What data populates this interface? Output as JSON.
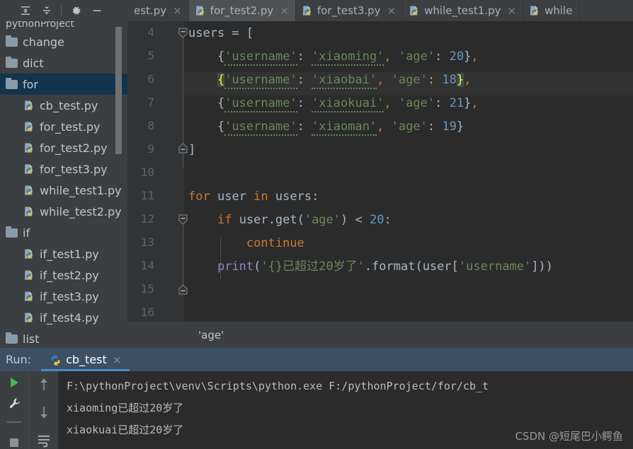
{
  "toolbar": {
    "expand_all": "expand-all",
    "collapse_all": "collapse-all",
    "settings": "settings",
    "minimize": "minimize"
  },
  "tabs": [
    {
      "label": "est.py",
      "active": false,
      "truncated": true
    },
    {
      "label": "for_test2.py",
      "active": true
    },
    {
      "label": "for_test3.py",
      "active": false
    },
    {
      "label": "while_test1.py",
      "active": false
    },
    {
      "label": "while",
      "active": false,
      "truncated": true
    }
  ],
  "close_glyph": "×",
  "sidebar": {
    "project_header": "pythonProject",
    "items": [
      {
        "label": "change",
        "type": "folder",
        "selected": false
      },
      {
        "label": "dict",
        "type": "folder",
        "selected": false
      },
      {
        "label": "for",
        "type": "folder",
        "selected": true
      },
      {
        "label": "cb_test.py",
        "type": "file",
        "selected": false
      },
      {
        "label": "for_test.py",
        "type": "file",
        "selected": false
      },
      {
        "label": "for_test2.py",
        "type": "file",
        "selected": false
      },
      {
        "label": "for_test3.py",
        "type": "file",
        "selected": false
      },
      {
        "label": "while_test1.py",
        "type": "file",
        "selected": false
      },
      {
        "label": "while_test2.py",
        "type": "file",
        "selected": false
      },
      {
        "label": "if",
        "type": "folder",
        "selected": false
      },
      {
        "label": "if_test1.py",
        "type": "file",
        "selected": false
      },
      {
        "label": "if_test2.py",
        "type": "file",
        "selected": false
      },
      {
        "label": "if_test3.py",
        "type": "file",
        "selected": false
      },
      {
        "label": "if_test4.py",
        "type": "file",
        "selected": false
      },
      {
        "label": "list",
        "type": "folder",
        "selected": false
      }
    ]
  },
  "editor": {
    "first_visible_line": 4,
    "line_numbers": [
      "4",
      "5",
      "6",
      "7",
      "8",
      "9",
      "10",
      "11",
      "12",
      "13",
      "14",
      "15",
      "16"
    ],
    "current_line": 6,
    "code_text": {
      "l4": "users = [",
      "l5": "    {'username': 'xiaoming', 'age': 20},",
      "l6": "    {'username': 'xiaobai', 'age': 18},",
      "l7": "    {'username': 'xiaokuai', 'age': 21},",
      "l8": "    {'username': 'xiaoman', 'age': 19}",
      "l9": "]",
      "l10": "",
      "l11": "for user in users:",
      "l12": "    if user.get('age') < 20:",
      "l13": "        continue",
      "l14": "    print('{}已超过20岁了'.format(user['username']))",
      "l15": "",
      "l16": ""
    },
    "tokens": {
      "users": "users",
      "eq": " = ",
      "lbracket": "[",
      "rbracket": "]",
      "lbrace": "{",
      "rbrace": "}",
      "comma": ",",
      "colon_sp": ": ",
      "str_username": "'username'",
      "str_age": "'age'",
      "str_xiaoming": "'xiaoming'",
      "str_xiaobai": "'xiaobai'",
      "str_xiaokuai": "'xiaokuai'",
      "str_xiaoman": "'xiaoman'",
      "num20": "20",
      "num18": "18",
      "num21": "21",
      "num19": "19",
      "kw_for": "for",
      "var_user": "user",
      "kw_in": "in",
      "colon": ":",
      "kw_if": "if",
      "dot_get": ".get(",
      "close_paren": ")",
      "lt": " < ",
      "kw_continue": "continue",
      "fn_print": "print",
      "str_fmt": "'{}已超过20岁了'",
      "dot_format": ".format(",
      "user_idx_open": "[",
      "str_username2": "'username'",
      "user_idx_close": "]",
      "paren_close2": "))",
      "space": " "
    }
  },
  "breadcrumb": {
    "text": "'age'"
  },
  "run_panel": {
    "label": "Run:",
    "tab_name": "cb_test",
    "close_glyph": "×",
    "buttons": {
      "rerun": "run-icon",
      "settings": "wrench-icon",
      "stop": "stop-icon",
      "up": "arrow-up-icon",
      "down": "arrow-down-icon",
      "soft_wrap": "soft-wrap-icon"
    },
    "console_lines": [
      "F:\\pythonProject\\venv\\Scripts\\python.exe F:/pythonProject/for/cb_t",
      "xiaoming已超过20岁了",
      "xiaokuai已超过20岁了"
    ]
  },
  "watermark": {
    "text": "CSDN @短尾巴小鳄鱼"
  },
  "colors": {
    "panel_bg": "#3c3f41",
    "editor_bg": "#2b2b2b",
    "gutter_bg": "#313335",
    "selection_blue": "#13344f",
    "run_header_blue": "#3c4f63",
    "accent_blue": "#4a88c7",
    "keyword_orange": "#cc7832",
    "string_green": "#6a8759",
    "number_blue": "#6897bb",
    "default_text": "#a9b7c6",
    "brace_highlight_fg": "#ffef28",
    "brace_highlight_bg": "#3b5048"
  }
}
